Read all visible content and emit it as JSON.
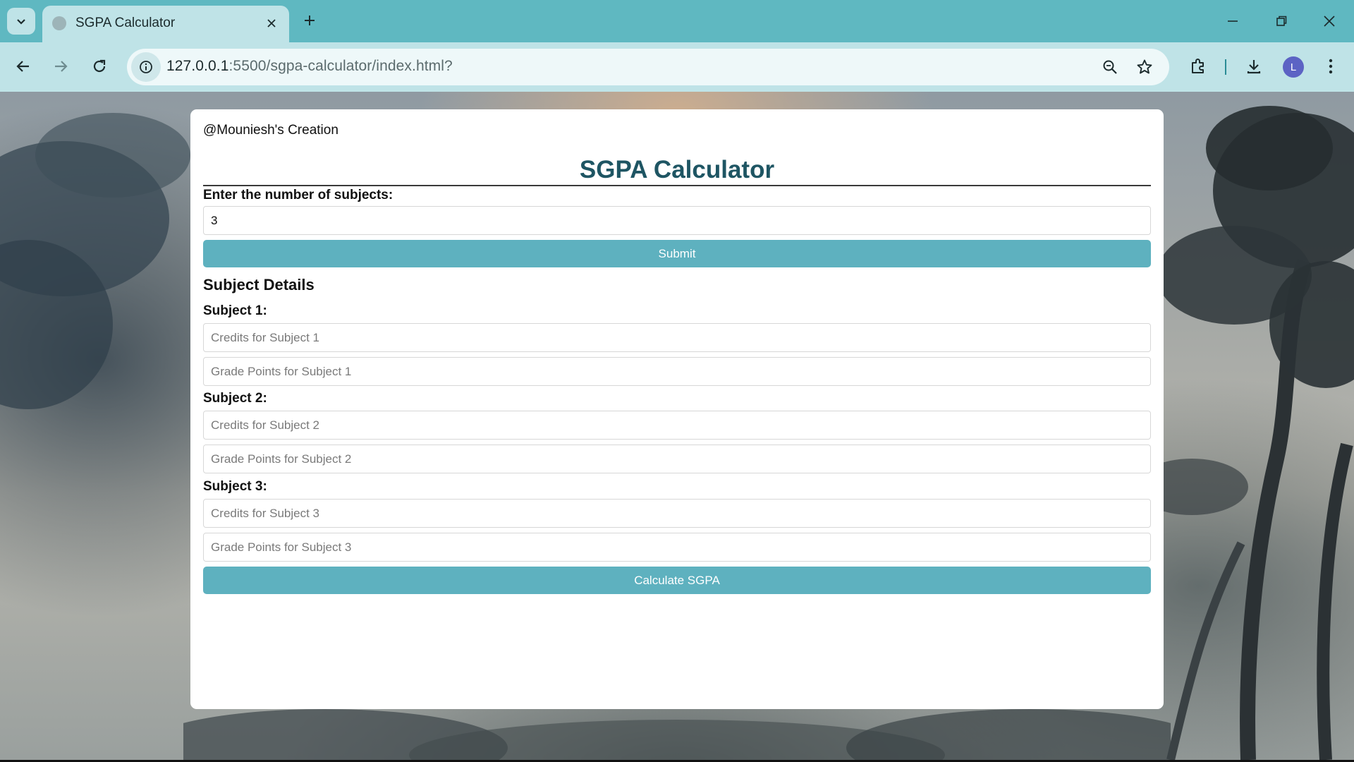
{
  "browser": {
    "tab_title": "SGPA Calculator",
    "url_host": "127.0.0.1",
    "url_rest": ":5500/sgpa-calculator/index.html?",
    "profile_initial": "L",
    "colors": {
      "tab_strip": "#5fb8c1",
      "toolbar": "#bfe3e7",
      "profile": "#5c63c4"
    },
    "icons": [
      "tab-search-chevron-icon",
      "globe-icon",
      "close-icon",
      "plus-icon",
      "minimize-icon",
      "restore-icon",
      "window-close-icon",
      "back-icon",
      "forward-icon",
      "reload-icon",
      "info-icon",
      "zoom-icon",
      "star-icon",
      "extensions-icon",
      "download-icon",
      "more-icon"
    ]
  },
  "page": {
    "credit": "@Mouniesh's Creation",
    "title": "SGPA Calculator",
    "subject_count_label": "Enter the number of subjects:",
    "subject_count_value": "3",
    "submit_label": "Submit",
    "details_heading": "Subject Details",
    "subjects": [
      {
        "label": "Subject 1:",
        "credits_placeholder": "Credits for Subject 1",
        "grade_placeholder": "Grade Points for Subject 1"
      },
      {
        "label": "Subject 2:",
        "credits_placeholder": "Credits for Subject 2",
        "grade_placeholder": "Grade Points for Subject 2"
      },
      {
        "label": "Subject 3:",
        "credits_placeholder": "Credits for Subject 3",
        "grade_placeholder": "Grade Points for Subject 3"
      }
    ],
    "calculate_label": "Calculate SGPA",
    "colors": {
      "title": "#1e5563",
      "button": "#5eb1bf"
    }
  }
}
